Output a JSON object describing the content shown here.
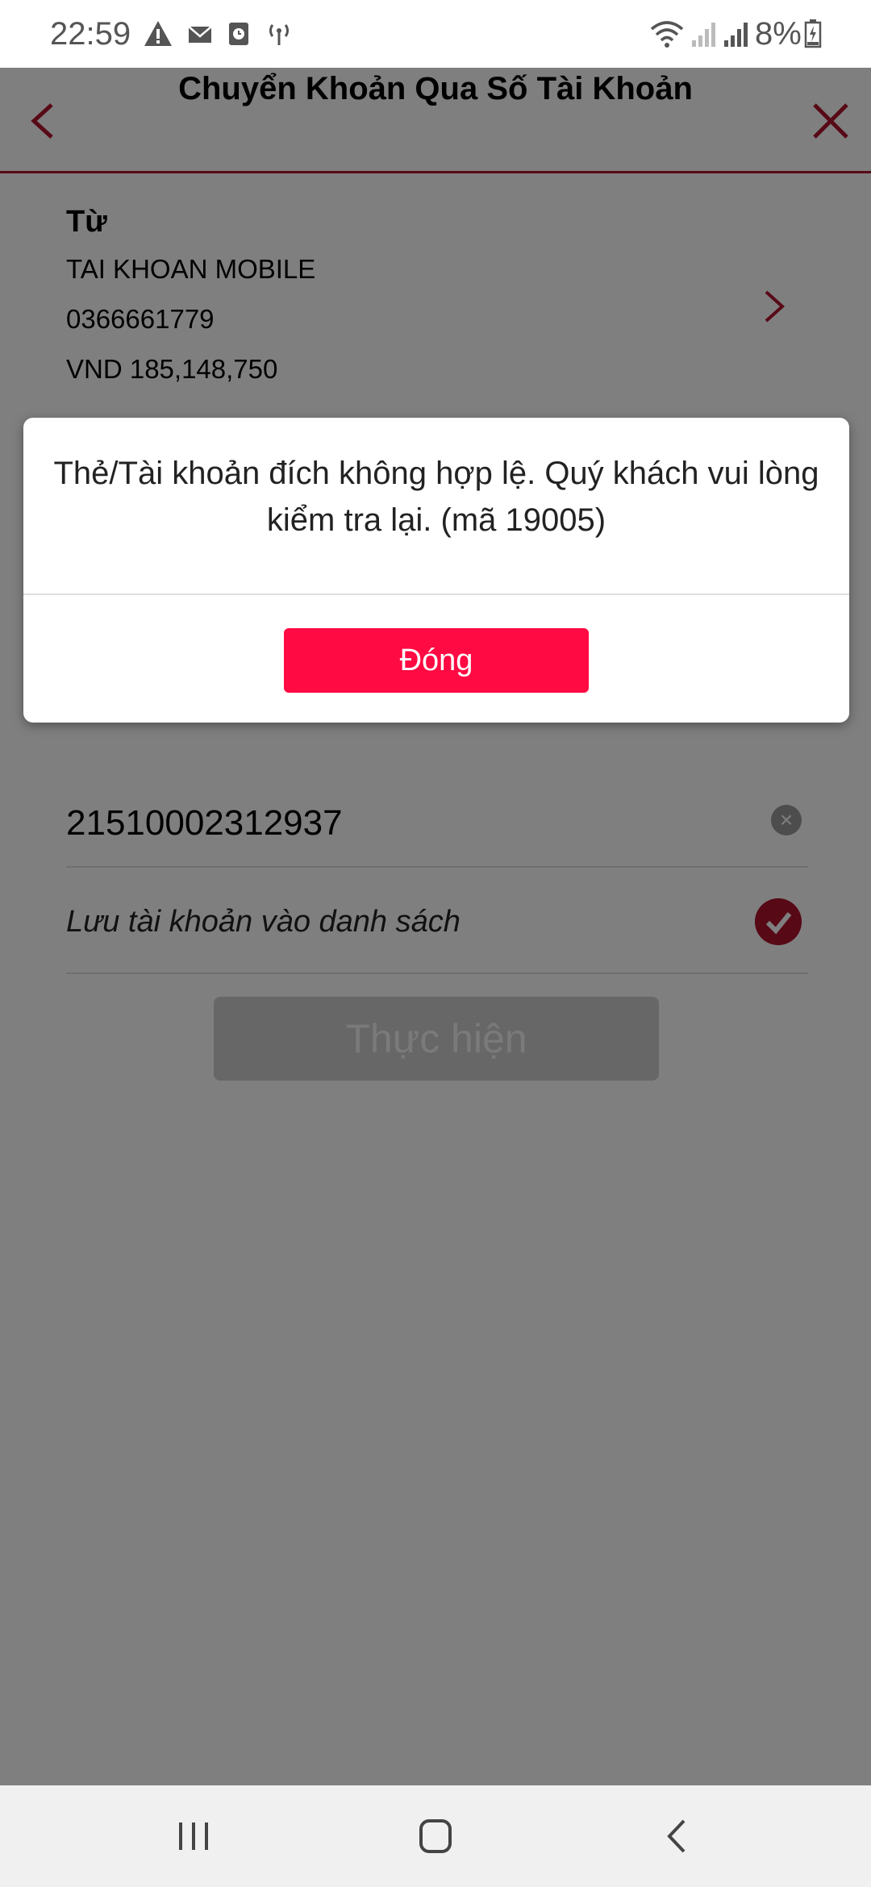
{
  "status_bar": {
    "time": "22:59",
    "battery": "8%",
    "icons": [
      "warning-icon",
      "mail-icon",
      "clock-icon",
      "hotspot-icon",
      "wifi-icon",
      "signal-icon",
      "signal-icon",
      "battery-charging-icon"
    ]
  },
  "header": {
    "title": "Chuyển Khoản Qua Số Tài Khoản",
    "back_icon": "chevron-left-icon",
    "close_icon": "close-icon"
  },
  "from_account": {
    "label": "Từ",
    "name": "TAI KHOAN MOBILE",
    "number": "0366661779",
    "balance": "VND 185,148,750"
  },
  "destination": {
    "account_number": "21510002312937",
    "save_label": "Lưu tài khoản vào danh sách",
    "save_checked": true
  },
  "submit_label": "Thực hiện",
  "dialog": {
    "message": "Thẻ/Tài khoản đích không hợp lệ. Quý khách vui lòng kiểm tra lại. (mã 19005)",
    "button_label": "Đóng"
  },
  "colors": {
    "accent": "#b0122d",
    "dialog_button": "#ff0a42",
    "overlay": "rgba(0,0,0,0.5)"
  }
}
